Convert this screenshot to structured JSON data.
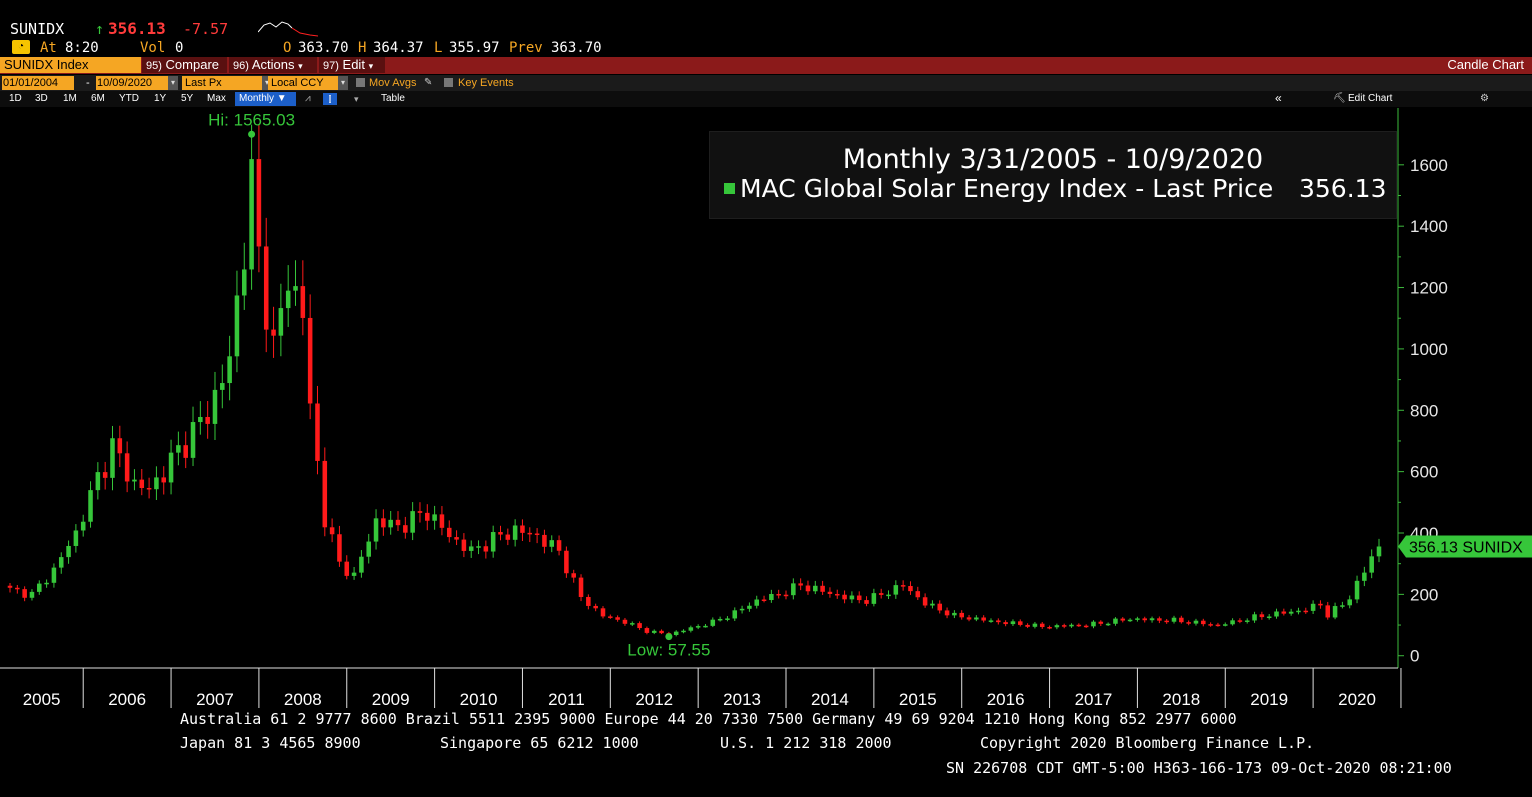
{
  "header": {
    "ticker": "SUNIDX",
    "up_arrow": "↑",
    "last": "356.13",
    "change": "-7.57",
    "at_label": "At",
    "time": "8:20",
    "vol_label": "Vol",
    "vol": "0",
    "open_label": "O",
    "open": "363.70",
    "high_label": "H",
    "high": "364.37",
    "low_label": "L",
    "low": "355.97",
    "prev_label": "Prev",
    "prev": "363.70",
    "gauge_icon": "speedometer-icon"
  },
  "toolbar": {
    "security": "SUNIDX Index",
    "compare_num": "95)",
    "compare": "Compare",
    "actions_num": "96)",
    "actions": "Actions",
    "edit_num": "97)",
    "edit": "Edit",
    "chart_type": "Candle Chart",
    "start_date": "01/01/2004",
    "dash": "-",
    "end_date": "10/09/2020",
    "field": "Last Px",
    "currency": "Local CCY",
    "mov_avgs": "Mov Avgs",
    "key_events": "Key Events",
    "ranges": [
      "1D",
      "3D",
      "1M",
      "6M",
      "YTD",
      "1Y",
      "5Y",
      "Max"
    ],
    "period": "Monthly",
    "table": "Table",
    "edit_chart": "Edit Chart"
  },
  "legend": {
    "title": "Monthly 3/31/2005 - 10/9/2020",
    "series_label": "MAC Global Solar Energy Index - Last Price",
    "series_value": "356.13"
  },
  "chart_data": {
    "type": "candlestick",
    "x_ticks": [
      "2005",
      "2006",
      "2007",
      "2008",
      "2009",
      "2010",
      "2011",
      "2012",
      "2013",
      "2014",
      "2015",
      "2016",
      "2017",
      "2018",
      "2019",
      "2020"
    ],
    "y_ticks": [
      0,
      200,
      400,
      600,
      800,
      1000,
      1200,
      1400,
      1600
    ],
    "ylim": [
      -40,
      1720
    ],
    "hi_label": "Hi: 1565.03",
    "low_label": "Low: 57.55",
    "last_label": "356.13 SUNIDX",
    "colors": {
      "up": "#36c63a",
      "down": "#ff1a1a",
      "axis": "#3dbb3d"
    },
    "anchors": [
      [
        "2005-03",
        215
      ],
      [
        "2005-06",
        200
      ],
      [
        "2005-09",
        280
      ],
      [
        "2005-12",
        400
      ],
      [
        "2006-03",
        580
      ],
      [
        "2006-05",
        680
      ],
      [
        "2006-08",
        560
      ],
      [
        "2006-10",
        540
      ],
      [
        "2006-12",
        600
      ],
      [
        "2007-03",
        700
      ],
      [
        "2007-06",
        790
      ],
      [
        "2007-09",
        960
      ],
      [
        "2007-12",
        1540
      ],
      [
        "2008-01",
        1300
      ],
      [
        "2008-03",
        1000
      ],
      [
        "2008-05",
        1230
      ],
      [
        "2008-07",
        1130
      ],
      [
        "2008-08",
        800
      ],
      [
        "2008-10",
        450
      ],
      [
        "2008-12",
        300
      ],
      [
        "2009-02",
        260
      ],
      [
        "2009-05",
        440
      ],
      [
        "2009-08",
        420
      ],
      [
        "2009-12",
        470
      ],
      [
        "2010-03",
        390
      ],
      [
        "2010-06",
        340
      ],
      [
        "2010-09",
        380
      ],
      [
        "2010-12",
        410
      ],
      [
        "2011-03",
        390
      ],
      [
        "2011-06",
        340
      ],
      [
        "2011-09",
        190
      ],
      [
        "2011-12",
        130
      ],
      [
        "2012-03",
        110
      ],
      [
        "2012-06",
        80
      ],
      [
        "2012-09",
        70
      ],
      [
        "2012-12",
        90
      ],
      [
        "2013-03",
        110
      ],
      [
        "2013-06",
        140
      ],
      [
        "2013-09",
        180
      ],
      [
        "2013-12",
        200
      ],
      [
        "2014-03",
        230
      ],
      [
        "2014-06",
        210
      ],
      [
        "2014-09",
        190
      ],
      [
        "2014-12",
        180
      ],
      [
        "2015-03",
        210
      ],
      [
        "2015-05",
        230
      ],
      [
        "2015-08",
        170
      ],
      [
        "2015-12",
        130
      ],
      [
        "2016-03",
        120
      ],
      [
        "2016-06",
        110
      ],
      [
        "2016-12",
        95
      ],
      [
        "2017-06",
        100
      ],
      [
        "2017-12",
        120
      ],
      [
        "2018-06",
        115
      ],
      [
        "2018-12",
        100
      ],
      [
        "2019-06",
        130
      ],
      [
        "2019-12",
        150
      ],
      [
        "2020-02",
        170
      ],
      [
        "2020-03",
        130
      ],
      [
        "2020-06",
        190
      ],
      [
        "2020-09",
        320
      ],
      [
        "2020-10",
        356
      ]
    ],
    "series": [
      {
        "name": "MAC Global Solar Energy Index - Last Price"
      }
    ]
  },
  "footer": {
    "line1": "Australia 61 2 9777 8600 Brazil 5511 2395 9000 Europe 44 20 7330 7500 Germany 49 69 9204 1210 Hong Kong 852 2977 6000",
    "line2a": "Japan 81 3 4565 8900",
    "line2b": "Singapore 65 6212 1000",
    "line2c": "U.S. 1 212 318 2000",
    "line2d": "Copyright 2020 Bloomberg Finance L.P.",
    "line3": "SN 226708 CDT  GMT-5:00 H363-166-173 09-Oct-2020 08:21:00"
  }
}
